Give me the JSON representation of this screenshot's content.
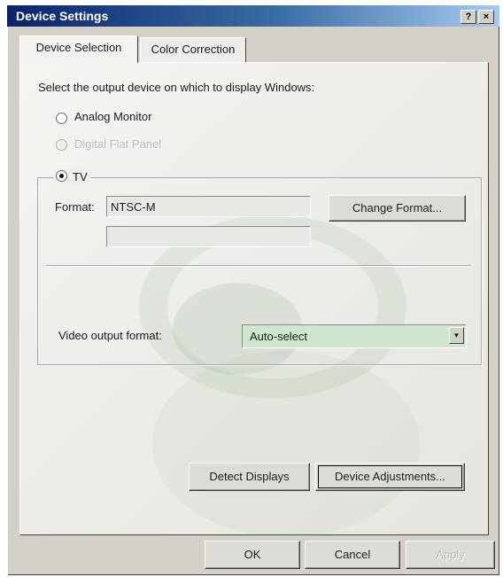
{
  "window": {
    "title": "Device Settings",
    "help_label": "?",
    "close_label": "×"
  },
  "tabs": [
    {
      "label": "Device Selection",
      "active": true
    },
    {
      "label": "Color Correction",
      "active": false
    }
  ],
  "device_selection": {
    "instruction": "Select the output device on which to display Windows:",
    "options": [
      {
        "label": "Analog Monitor",
        "checked": false,
        "enabled": true
      },
      {
        "label": "Digital Flat Panel",
        "checked": false,
        "enabled": false
      },
      {
        "label": "TV",
        "checked": true,
        "enabled": true
      }
    ]
  },
  "tv_group": {
    "format_label": "Format:",
    "format_value": "NTSC-M",
    "format_secondary_value": "",
    "change_format_button": "Change Format...",
    "video_output_label": "Video output format:",
    "video_output_value": "Auto-select"
  },
  "buttons": {
    "detect_displays": "Detect Displays",
    "device_adjustments": "Device Adjustments...",
    "ok": "OK",
    "cancel": "Cancel",
    "apply": "Apply"
  },
  "colors": {
    "title_bar_start": "#0a246a",
    "dialog_face": "#d4d0c8",
    "select_highlight": "#cfe6cf"
  }
}
